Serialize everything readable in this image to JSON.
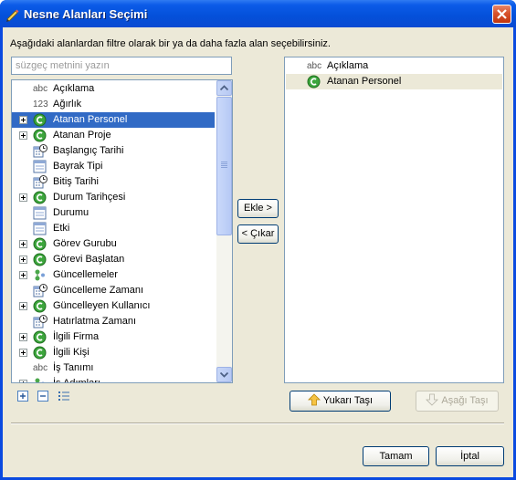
{
  "window": {
    "title": "Nesne Alanları Seçimi"
  },
  "instruction": "Aşağıdaki alanlardan filtre olarak bir ya da daha fazla alan seçebilirsiniz.",
  "filter": {
    "placeholder": "süzgeç metnini yazın",
    "value": ""
  },
  "available_fields": [
    {
      "label": "Açıklama",
      "icon": "abc-text-icon",
      "expandable": false
    },
    {
      "label": "Ağırlık",
      "icon": "123-number-icon",
      "expandable": false
    },
    {
      "label": "Atanan Personel",
      "icon": "green-c-icon",
      "expandable": true,
      "selected": true
    },
    {
      "label": "Atanan Proje",
      "icon": "green-c-icon",
      "expandable": true
    },
    {
      "label": "Başlangıç Tarihi",
      "icon": "date-clock-icon",
      "expandable": false
    },
    {
      "label": "Bayrak Tipi",
      "icon": "enum-table-icon",
      "expandable": false
    },
    {
      "label": "Bitiş Tarihi",
      "icon": "date-clock-icon",
      "expandable": false
    },
    {
      "label": "Durum Tarihçesi",
      "icon": "green-c-icon",
      "expandable": true
    },
    {
      "label": "Durumu",
      "icon": "enum-table-icon",
      "expandable": false
    },
    {
      "label": "Etki",
      "icon": "enum-table-icon",
      "expandable": false
    },
    {
      "label": "Görev Gurubu",
      "icon": "green-c-icon",
      "expandable": true
    },
    {
      "label": "Görevi Başlatan",
      "icon": "green-c-icon",
      "expandable": true
    },
    {
      "label": "Güncellemeler",
      "icon": "collection-icon",
      "expandable": true
    },
    {
      "label": "Güncelleme Zamanı",
      "icon": "date-clock-icon",
      "expandable": false
    },
    {
      "label": "Güncelleyen Kullanıcı",
      "icon": "green-c-icon",
      "expandable": true
    },
    {
      "label": "Hatırlatma Zamanı",
      "icon": "date-clock-icon",
      "expandable": false
    },
    {
      "label": "İlgili Firma",
      "icon": "green-c-icon",
      "expandable": true
    },
    {
      "label": "İlgili Kişi",
      "icon": "green-c-icon",
      "expandable": true
    },
    {
      "label": "İş Tanımı",
      "icon": "abc-text-icon",
      "expandable": false
    },
    {
      "label": "İş Adımları",
      "icon": "collection-icon",
      "expandable": true
    }
  ],
  "selected_fields": [
    {
      "label": "Açıklama",
      "icon": "abc-text-icon"
    },
    {
      "label": "Atanan Personel",
      "icon": "green-c-icon",
      "highlighted": true
    }
  ],
  "buttons": {
    "add": "Ekle >",
    "remove": "< Çıkar",
    "move_up": "Yukarı Taşı",
    "move_down": "Aşağı Taşı",
    "ok": "Tamam",
    "cancel": "İptal"
  },
  "icon_text": {
    "abc": "abc",
    "num": "123"
  },
  "colors": {
    "selection": "#316ac5",
    "title_bar": "#0a4ae0",
    "dialog_bg": "#ece9d8"
  }
}
